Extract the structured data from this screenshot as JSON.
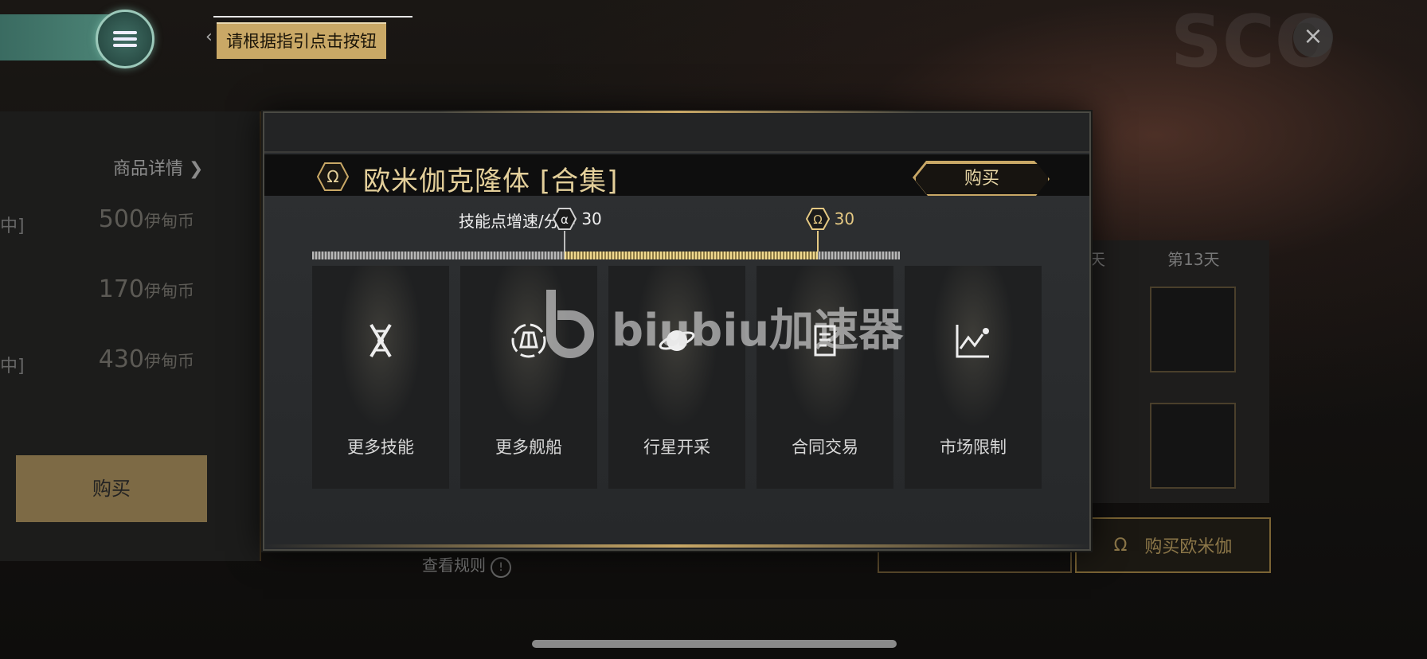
{
  "hud": {
    "guide_text": "请根据指引点击按钮",
    "back_glyph": "‹",
    "close_glyph": "×"
  },
  "left_panel": {
    "detail_link": "商品详情 ❯",
    "rows": [
      {
        "bracket": "中]",
        "amount": "500",
        "currency": "伊甸币"
      },
      {
        "bracket": "",
        "amount": "170",
        "currency": "伊甸币"
      },
      {
        "bracket": "中]",
        "amount": "430",
        "currency": "伊甸币"
      }
    ],
    "buy_label": "购买"
  },
  "background": {
    "rule_link": "查看规则",
    "rule_icon": "!",
    "day_label_partial": "天",
    "day_label": "第13天",
    "buy_omega_label": "购买欧米伽",
    "omega_symbol": "Ω"
  },
  "modal": {
    "title": "欧米伽克隆体 [合集]",
    "buy_label": "购买",
    "rate_label": "技能点增速/分钟",
    "alpha_symbol": "α",
    "omega_symbol": "Ω",
    "alpha_value": "30",
    "omega_value": "30",
    "alpha_progress": 0.43,
    "omega_progress": 0.86,
    "cards": [
      {
        "label": "更多技能",
        "icon": "dna-icon"
      },
      {
        "label": "更多舰船",
        "icon": "ship-icon"
      },
      {
        "label": "行星开采",
        "icon": "planet-icon"
      },
      {
        "label": "合同交易",
        "icon": "contract-icon"
      },
      {
        "label": "市场限制",
        "icon": "market-chart-icon"
      }
    ]
  },
  "watermark": {
    "text": "biubiu加速器"
  },
  "colors": {
    "gold": "#c9a866",
    "teal": "#4d8577"
  }
}
